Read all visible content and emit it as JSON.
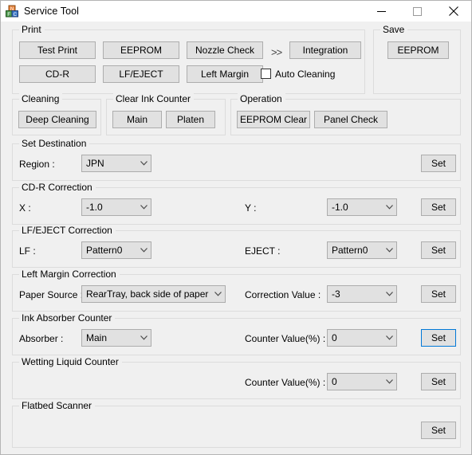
{
  "window": {
    "title": "Service Tool",
    "icon": "app-blocks-icon",
    "controls": {
      "minimize": "minimize-icon",
      "maximize": "maximize-icon",
      "close": "close-icon"
    }
  },
  "colors": {
    "window_bg": "#f0f0f0",
    "titlebar_bg": "#ffffff",
    "button_face": "#e1e1e1",
    "button_border": "#adadad",
    "group_border": "#dcdcdc",
    "focus_accent": "#0078d7",
    "text": "#000000"
  },
  "groups": {
    "print": {
      "legend": "Print",
      "buttons": [
        {
          "label": "Test Print"
        },
        {
          "label": "EEPROM"
        },
        {
          "label": "Nozzle Check"
        },
        {
          "label": "Integration"
        },
        {
          "label": "CD-R"
        },
        {
          "label": "LF/EJECT"
        },
        {
          "label": "Left Margin"
        }
      ],
      "separator": ">>",
      "auto_cleaning": {
        "label": "Auto Cleaning",
        "checked": false
      }
    },
    "save": {
      "legend": "Save",
      "buttons": [
        {
          "label": "EEPROM"
        }
      ]
    },
    "cleaning": {
      "legend": "Cleaning",
      "buttons": [
        {
          "label": "Deep Cleaning"
        }
      ]
    },
    "clear_ink_counter": {
      "legend": "Clear Ink Counter",
      "buttons": [
        {
          "label": "Main"
        },
        {
          "label": "Platen"
        }
      ]
    },
    "operation": {
      "legend": "Operation",
      "buttons": [
        {
          "label": "EEPROM Clear"
        },
        {
          "label": "Panel Check"
        }
      ]
    },
    "set_destination": {
      "legend": "Set Destination",
      "region_label": "Region :",
      "region_value": "JPN",
      "set_label": "Set"
    },
    "cdr_correction": {
      "legend": "CD-R Correction",
      "x_label": "X :",
      "x_value": "-1.0",
      "y_label": "Y :",
      "y_value": "-1.0",
      "set_label": "Set"
    },
    "lf_eject_correction": {
      "legend": "LF/EJECT Correction",
      "lf_label": "LF :",
      "lf_value": "Pattern0",
      "eject_label": "EJECT :",
      "eject_value": "Pattern0",
      "set_label": "Set"
    },
    "left_margin_correction": {
      "legend": "Left Margin Correction",
      "paper_source_label": "Paper Source :",
      "paper_source_value": "RearTray, back side of paper",
      "correction_label": "Correction Value :",
      "correction_value": "-3",
      "set_label": "Set"
    },
    "ink_absorber_counter": {
      "legend": "Ink Absorber Counter",
      "absorber_label": "Absorber :",
      "absorber_value": "Main",
      "counter_label": "Counter Value(%) :",
      "counter_value": "0",
      "set_label": "Set",
      "set_focused": true
    },
    "wetting_liquid_counter": {
      "legend": "Wetting Liquid Counter",
      "counter_label": "Counter Value(%) :",
      "counter_value": "0",
      "set_label": "Set"
    },
    "flatbed_scanner": {
      "legend": "Flatbed Scanner",
      "set_label": "Set"
    }
  }
}
